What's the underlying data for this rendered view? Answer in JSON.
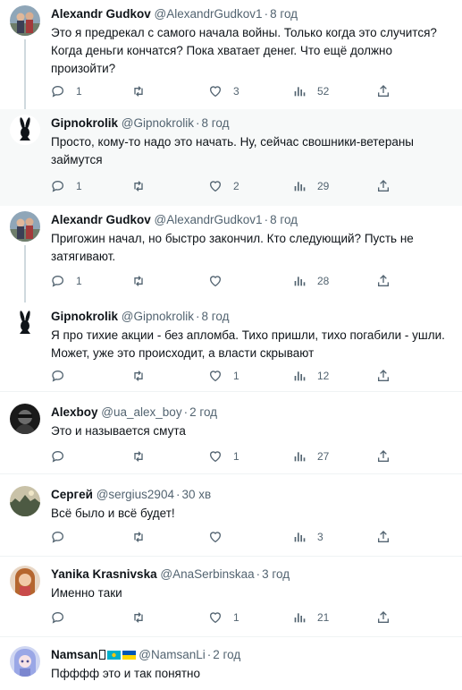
{
  "tweets": [
    {
      "name": "Alexandr Gudkov",
      "handle": "@AlexandrGudkov1",
      "time": "8 год",
      "text": "Это я предрекал с самого начала войны.  Только когда это случится? Когда деньги кончатся? Пока хватает денег. Что ещё должно произойти?",
      "replies": "1",
      "retweets": "",
      "likes": "3",
      "views": "52",
      "avatar": "photo-couple"
    },
    {
      "name": "Gipnokrolik",
      "handle": "@Gipnokrolik",
      "time": "8 год",
      "text": "Просто, кому-то надо это начать. Ну, сейчас свошники-ветераны займутся",
      "replies": "1",
      "retweets": "",
      "likes": "2",
      "views": "29",
      "avatar": "bunny-logo"
    },
    {
      "name": "Alexandr Gudkov",
      "handle": "@AlexandrGudkov1",
      "time": "8 год",
      "text": "Пригожин начал, но быстро  закончил. Кто следующий? Пусть не затягивают.",
      "replies": "1",
      "retweets": "",
      "likes": "",
      "views": "28",
      "avatar": "photo-couple"
    },
    {
      "name": "Gipnokrolik",
      "handle": "@Gipnokrolik",
      "time": "8 год",
      "text": "Я про тихие акции - без апломба. Тихо пришли, тихо погабили - ушли. Может, уже это происходит, а власти скрывают",
      "replies": "",
      "retweets": "",
      "likes": "1",
      "views": "12",
      "avatar": "bunny-logo"
    },
    {
      "name": "Alexboy",
      "handle": "@ua_alex_boy",
      "time": "2 год",
      "text": "Это и называется смута",
      "replies": "",
      "retweets": "",
      "likes": "1",
      "views": "27",
      "avatar": "photo-dark"
    },
    {
      "name": "Сергей",
      "handle": "@sergius2904",
      "time": "30 хв",
      "text": "Всё было и всё будет!",
      "replies": "",
      "retweets": "",
      "likes": "",
      "views": "3",
      "avatar": "photo-landscape"
    },
    {
      "name": "Yanika Krasnivska",
      "handle": "@AnaSerbinskaa",
      "time": "3 год",
      "text": "Именно таки",
      "replies": "",
      "retweets": "",
      "likes": "1",
      "views": "21",
      "avatar": "photo-girl"
    },
    {
      "name": "Namsan",
      "handle": "@NamsanLi",
      "time": "2 год",
      "text": "Пфффф это и так понятно",
      "replies": "",
      "retweets": "",
      "likes": "",
      "views": "",
      "avatar": "photo-anime"
    }
  ],
  "separator": "·",
  "icons": [
    "reply-icon",
    "retweet-icon",
    "like-icon",
    "views-icon",
    "share-icon"
  ],
  "colors": {
    "muted": "#536471",
    "highlight_bg": "#f7f9f9",
    "thread_line": "#cfd9de"
  }
}
